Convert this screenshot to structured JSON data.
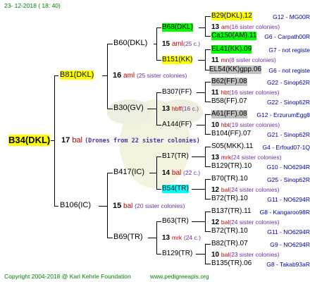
{
  "header_date": "23- 12-2018 ( 18: 40)",
  "footer": {
    "copyright": "Copyright 2004-2018 @ Karl Kehrle Foundation",
    "site": "www.pedigreeapis.org"
  },
  "root": {
    "id": "B34(DKL)",
    "num": "17",
    "abbr": "bal",
    "note": "(Drones from 22 sister colonies)"
  },
  "g1": {
    "upper": {
      "id": "B81(DKL)",
      "num": "16",
      "abbr": "aml",
      "note": "(25 sister colonies)"
    },
    "lower": {
      "id": "B106(IC)",
      "num": "15",
      "abbr": "bal",
      "note": "(20 sister colonies)"
    }
  },
  "g2": {
    "b60": {
      "id": "B60(DKL)",
      "num": "15",
      "abbr": "aml",
      "note": "(25 c.)"
    },
    "b30": {
      "id": "B30(GV)",
      "num": "13",
      "abbr": "hbff",
      "note": "(16 c.)"
    },
    "b417": {
      "id": "B417(IC)",
      "num": "14",
      "abbr": "bal",
      "note": "(22 c.)"
    },
    "b69": {
      "id": "B69(TR)",
      "num": "13",
      "abbr": "mrk",
      "note": "(24 c.)"
    }
  },
  "g3": [
    {
      "id": "B68(DKL)"
    },
    {
      "id": "B151(KK)"
    },
    {
      "id": "B307(FF)"
    },
    {
      "id": "A144(FF)"
    },
    {
      "id": "B17(TR)"
    },
    {
      "id": "B54(TR)"
    },
    {
      "id": "B63(TR)"
    },
    {
      "id": "B129(TR)"
    }
  ],
  "g4": [
    {
      "id": "B29(DKL).12",
      "pedi": "G12 - MG00R"
    },
    {
      "num": "13",
      "abbr": "am",
      "note": "(16 sister colonies)"
    },
    {
      "id": "Ca150(AM).11",
      "pedi": "G6 - Carpath00R"
    },
    {
      "id": "EL41(KK).09",
      "pedi": "G7 - not registe"
    },
    {
      "num": "11",
      "abbr": "mn",
      "note": "(8 sister colonies)"
    },
    {
      "id": "EL54(KK)gpp.06",
      "pedi": "G6 - not registe"
    },
    {
      "id": "B62(FF).08",
      "pedi": "G22 - Sinop62R"
    },
    {
      "num": "11",
      "abbr": "hbt",
      "note": "(16 sister colonies)"
    },
    {
      "id": "B58(FF).07",
      "pedi": "G22 - Sinop62R"
    },
    {
      "id": "A61(FF).08",
      "pedi": "G12 - ErzurumEgg8"
    },
    {
      "num": "10",
      "abbr": "hbt",
      "note": "(19 sister colonies)"
    },
    {
      "id": "B104(FF).07",
      "pedi": "G21 - Sinop62R"
    },
    {
      "id": "S05(MKK).11",
      "pedi": "G4 - Erfoud07-1Q"
    },
    {
      "num": "13",
      "abbr": "mrk",
      "note": "(24 sister colonies)"
    },
    {
      "id": "B129(TR).10",
      "pedi": "G10 - NO6294R"
    },
    {
      "id": "B70(TR).10",
      "pedi": "G25 - Sinop62R"
    },
    {
      "num": "12",
      "abbr": "bal",
      "note": "(24 sister colonies)"
    },
    {
      "id": "B72(TR).10",
      "pedi": "G11 - NO6294R"
    },
    {
      "id": "B137(TR).11",
      "pedi": "G8 - Kangaroo98R"
    },
    {
      "num": "12",
      "abbr": "bal",
      "note": "(24 sister colonies)"
    },
    {
      "id": "B72(TR).10",
      "pedi": "G11 - NO6294R"
    },
    {
      "id": "B82(TR).07",
      "pedi": "G9 - NO6294R"
    },
    {
      "num": "10",
      "abbr": "bal",
      "note": "(23 sister colonies)"
    },
    {
      "id": "B135(TR).06",
      "pedi": "G8 - Takab93aR"
    }
  ],
  "colors": {
    "yellow": "#ffff00",
    "green": "#00ff00",
    "gray": "#c0c0c0",
    "cyan": "#00ffff",
    "red": "#c00000",
    "blue": "#0000a0",
    "footer_green": "#008000"
  }
}
